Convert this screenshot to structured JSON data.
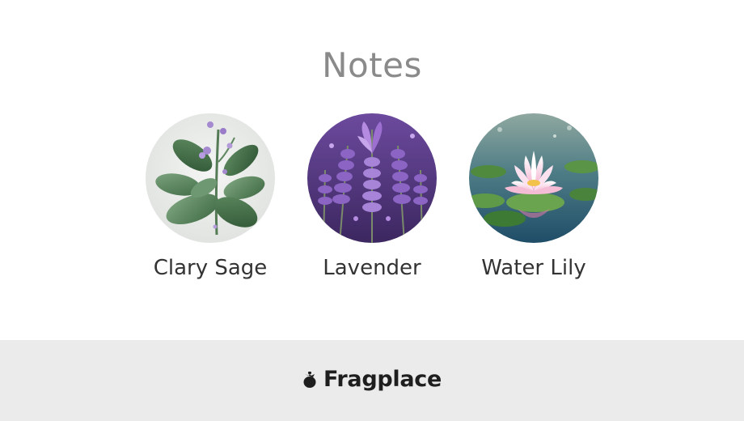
{
  "notes": {
    "title": "Notes",
    "items": [
      {
        "label": "Clary Sage",
        "image": "clary-sage-image"
      },
      {
        "label": "Lavender",
        "image": "lavender-image"
      },
      {
        "label": "Water Lily",
        "image": "water-lily-image"
      }
    ]
  },
  "footer": {
    "brand": "Fragplace",
    "logo_icon": "fragplace-logo-icon"
  },
  "colors": {
    "title": "#8a8a8a",
    "label": "#333333",
    "footer_bg": "#ebebeb",
    "brand_text": "#1e1e1e"
  }
}
